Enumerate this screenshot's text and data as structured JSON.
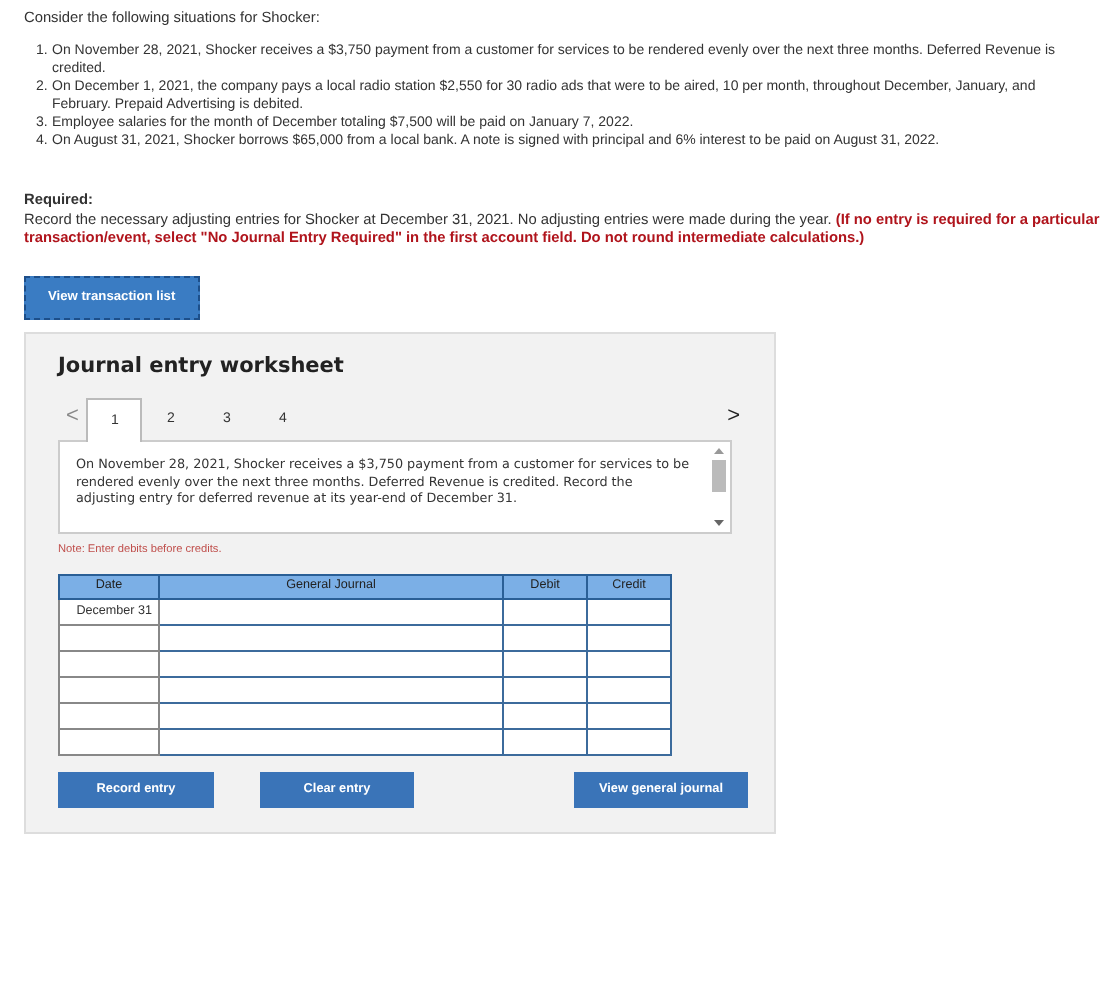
{
  "intro": "Consider the following situations for Shocker:",
  "situations": [
    {
      "number": "1.",
      "text": "On November 28, 2021, Shocker receives a $3,750 payment from a customer for services to be rendered evenly over the next three months. Deferred Revenue is credited."
    },
    {
      "number": "2.",
      "text": "On December 1, 2021, the company pays a local radio station $2,550 for 30 radio ads that were to be aired, 10 per month, throughout December, January, and February. Prepaid Advertising is debited."
    },
    {
      "number": "3.",
      "text": "Employee salaries for the month of December totaling $7,500 will be paid on January 7, 2022."
    },
    {
      "number": "4.",
      "text": "On August 31, 2021, Shocker borrows $65,000 from a local bank. A note is signed with principal and 6% interest to be paid on August 31, 2022."
    }
  ],
  "required": {
    "heading": "Required:",
    "text": "Record the necessary adjusting entries for Shocker at December 31, 2021. No adjusting entries were made during the year.",
    "instruction": "(If no entry is required for a particular transaction/event, select \"No Journal Entry Required\" in the first account field. Do not round intermediate calculations.)"
  },
  "view_transaction_button": "View transaction list",
  "worksheet": {
    "title": "Journal entry worksheet",
    "prev": "<",
    "next": ">",
    "tabs": [
      {
        "label": "1",
        "selected": true
      },
      {
        "label": "2",
        "selected": false
      },
      {
        "label": "3",
        "selected": false
      },
      {
        "label": "4",
        "selected": false
      }
    ],
    "description": "On November 28, 2021, Shocker receives a $3,750 payment from a customer for services to be rendered evenly over the next three months. Deferred Revenue is credited. Record the adjusting entry for deferred revenue at its year-end of December 31.",
    "note": "Note: Enter debits before credits.",
    "table": {
      "columns": [
        "Date",
        "General Journal",
        "Debit",
        "Credit"
      ],
      "rows": [
        {
          "date": "December 31"
        },
        {},
        {},
        {},
        {},
        {}
      ]
    },
    "buttons": [
      "Record entry",
      "Clear entry",
      "View general journal"
    ]
  }
}
